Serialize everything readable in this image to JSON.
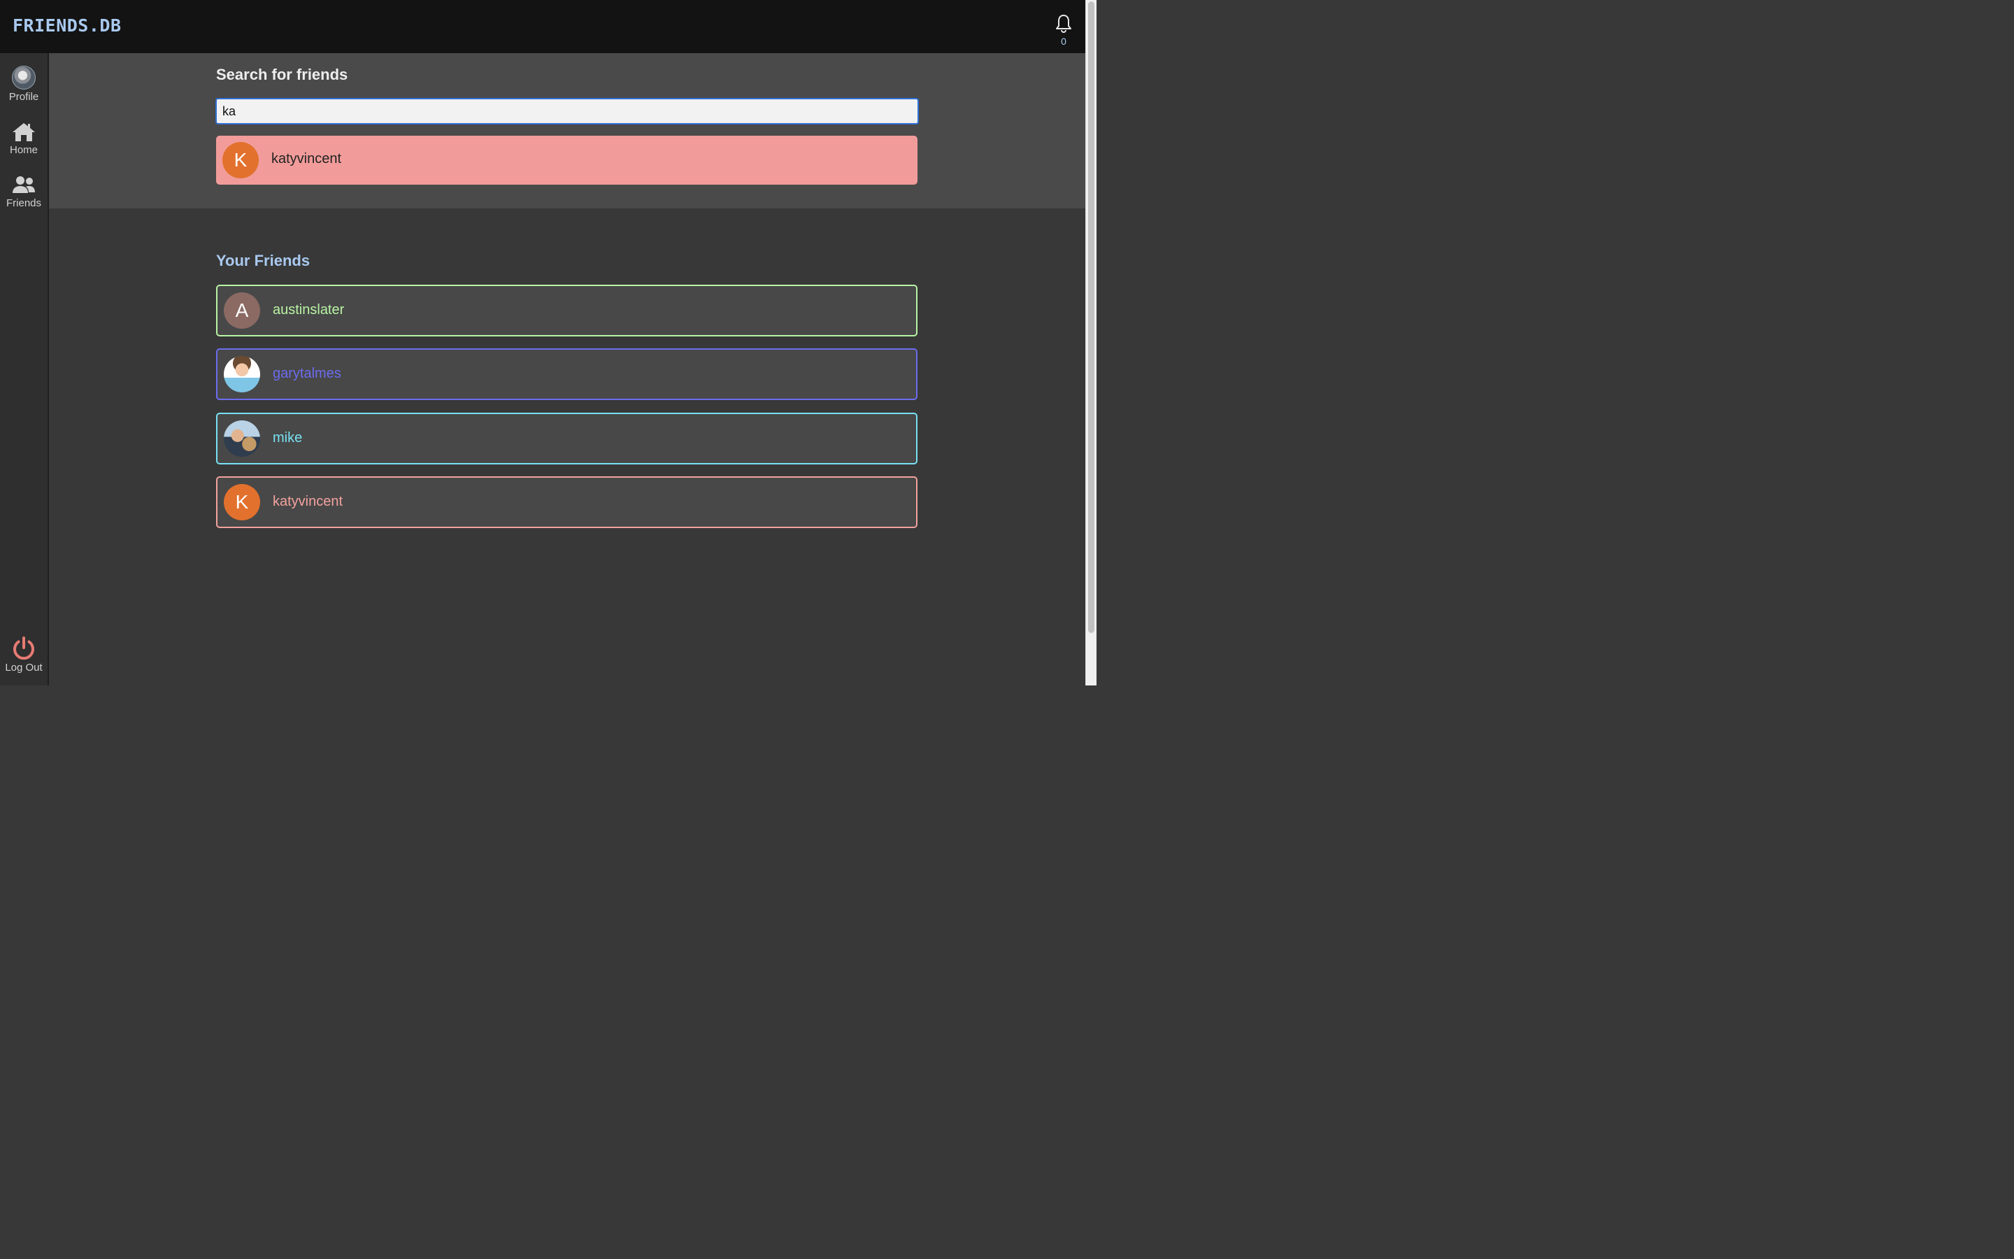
{
  "header": {
    "logo": "FRIENDS.DB",
    "notifications_count": "0"
  },
  "sidebar": {
    "items": [
      {
        "label": "Profile"
      },
      {
        "label": "Home"
      },
      {
        "label": "Friends"
      }
    ],
    "logout_label": "Log Out"
  },
  "search": {
    "title": "Search for friends",
    "value": "ka",
    "results": [
      {
        "initial": "K",
        "username": "katyvincent"
      }
    ]
  },
  "friends": {
    "title": "Your Friends",
    "list": [
      {
        "initial": "A",
        "username": "austinslater",
        "color": "#b8f4a4"
      },
      {
        "initial": "",
        "username": "garytalmes",
        "color": "#6c6cf0"
      },
      {
        "initial": "",
        "username": "mike",
        "color": "#78e2f2"
      },
      {
        "initial": "K",
        "username": "katyvincent",
        "color": "#f3a29e"
      }
    ]
  },
  "colors": {
    "accent": "#a9c9ef",
    "search_result_bg": "#f19c9a",
    "input_focus": "#2f6fd6",
    "logout": "#e77b74"
  }
}
